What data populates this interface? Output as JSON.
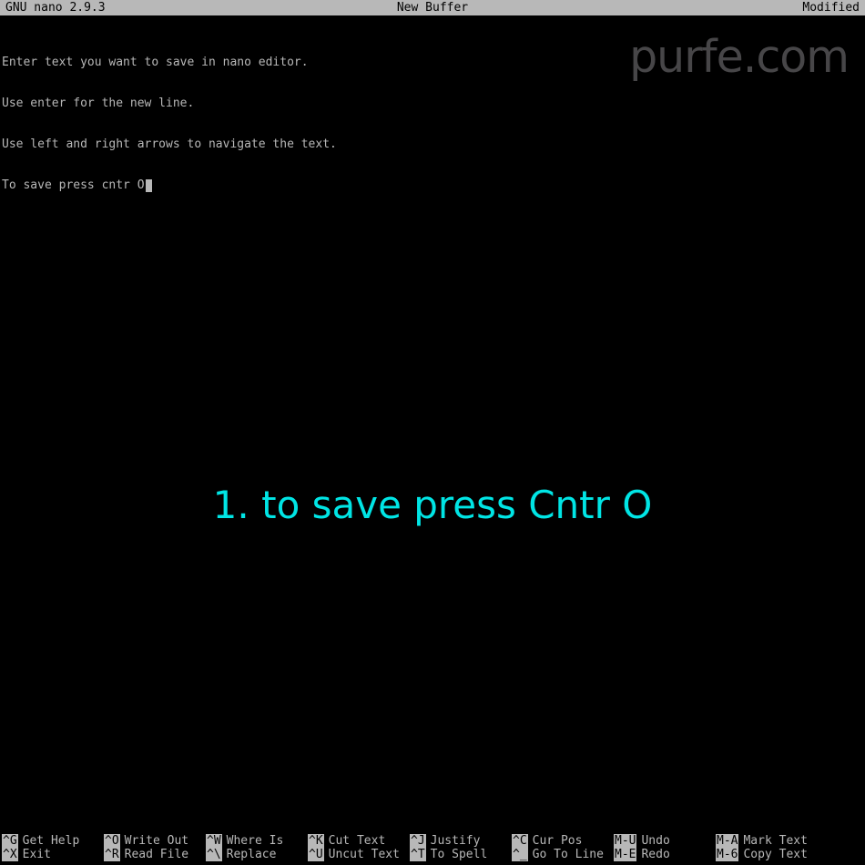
{
  "titlebar": {
    "left": "GNU nano 2.9.3",
    "center": "New Buffer",
    "right": "Modified"
  },
  "editor": {
    "lines": [
      "Enter text you want to save in nano editor.",
      "Use enter for the new line.",
      "Use left and right arrows to navigate the text.",
      "To save press cntr O"
    ]
  },
  "watermark": "purfe.com",
  "overlay": "1. to save press Cntr O",
  "help": {
    "col0": {
      "item0": {
        "key": "^G",
        "label": "Get Help"
      },
      "item1": {
        "key": "^X",
        "label": "Exit"
      }
    },
    "col1": {
      "item0": {
        "key": "^O",
        "label": "Write Out"
      },
      "item1": {
        "key": "^R",
        "label": "Read File"
      }
    },
    "col2": {
      "item0": {
        "key": "^W",
        "label": "Where Is"
      },
      "item1": {
        "key": "^\\",
        "label": "Replace"
      }
    },
    "col3": {
      "item0": {
        "key": "^K",
        "label": "Cut Text"
      },
      "item1": {
        "key": "^U",
        "label": "Uncut Text"
      }
    },
    "col4": {
      "item0": {
        "key": "^J",
        "label": "Justify"
      },
      "item1": {
        "key": "^T",
        "label": "To Spell"
      }
    },
    "col5": {
      "item0": {
        "key": "^C",
        "label": "Cur Pos"
      },
      "item1": {
        "key": "^_",
        "label": "Go To Line"
      }
    },
    "col6": {
      "item0": {
        "key": "M-U",
        "label": "Undo"
      },
      "item1": {
        "key": "M-E",
        "label": "Redo"
      }
    },
    "col7": {
      "item0": {
        "key": "M-A",
        "label": "Mark Text"
      },
      "item1": {
        "key": "M-6",
        "label": "Copy Text"
      }
    }
  }
}
